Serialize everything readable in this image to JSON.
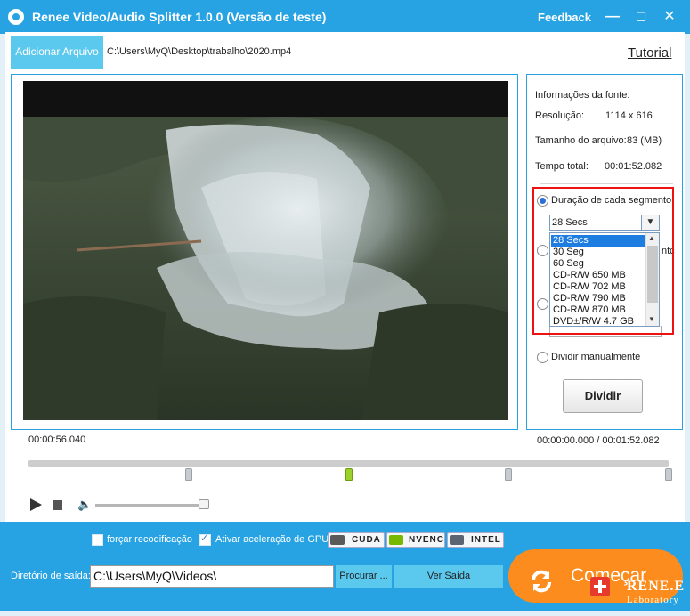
{
  "window": {
    "title": "Renee Video/Audio Splitter 1.0.0 (Versão de teste)",
    "feedback": "Feedback",
    "minimize": "—",
    "maximize": "☐",
    "close": "✕"
  },
  "toolbar": {
    "add_file": "Adicionar Arquivo",
    "file_path": "C:\\Users\\MyQ\\Desktop\\trabalho\\2020.mp4",
    "tutorial": "Tutorial"
  },
  "info": {
    "header": "Informações da fonte:",
    "resolution_label": "Resolução:",
    "resolution_value": "1114 x 616",
    "size_label": "Tamanho do arquivo:",
    "size_value": "83 (MB)",
    "duration_label": "Tempo total:",
    "duration_value": "00:01:52.082"
  },
  "split": {
    "option_duration": "Duração de cada segmento",
    "option_partial": "ntc",
    "selected": "28 Secs",
    "options": [
      "28 Secs",
      "30 Seg",
      "60 Seg",
      "CD-R/W 650 MB",
      "CD-R/W 702 MB",
      "CD-R/W 790 MB",
      "CD-R/W 870 MB",
      "DVD±/R/W 4.7 GB"
    ],
    "option_manual": "Dividir manualmente",
    "divide_button": "Dividir"
  },
  "player": {
    "current_time": "00:00:56.040",
    "range_time": "00:00:00.000 / 00:01:52.082",
    "volume": 0.95
  },
  "bottom": {
    "force_reencode": "forçar recodificação",
    "gpu_accel": "Ativar aceleração de GPU",
    "gpu_badges": [
      "CUDA",
      "NVENC",
      "INTEL"
    ],
    "output_label": "Diretório de saída:",
    "output_path": "C:\\Users\\MyQ\\Videos\\",
    "browse": "Procurar ...",
    "view_output": "Ver Saída",
    "start": "Começar",
    "watermark_brand": "RENE.E",
    "watermark_sub": "Laboratory"
  },
  "colors": {
    "brand_blue": "#27a3e3",
    "light_blue": "#5bc8ee",
    "start_orange": "#fb8c1d",
    "highlight_red": "#e11111"
  }
}
